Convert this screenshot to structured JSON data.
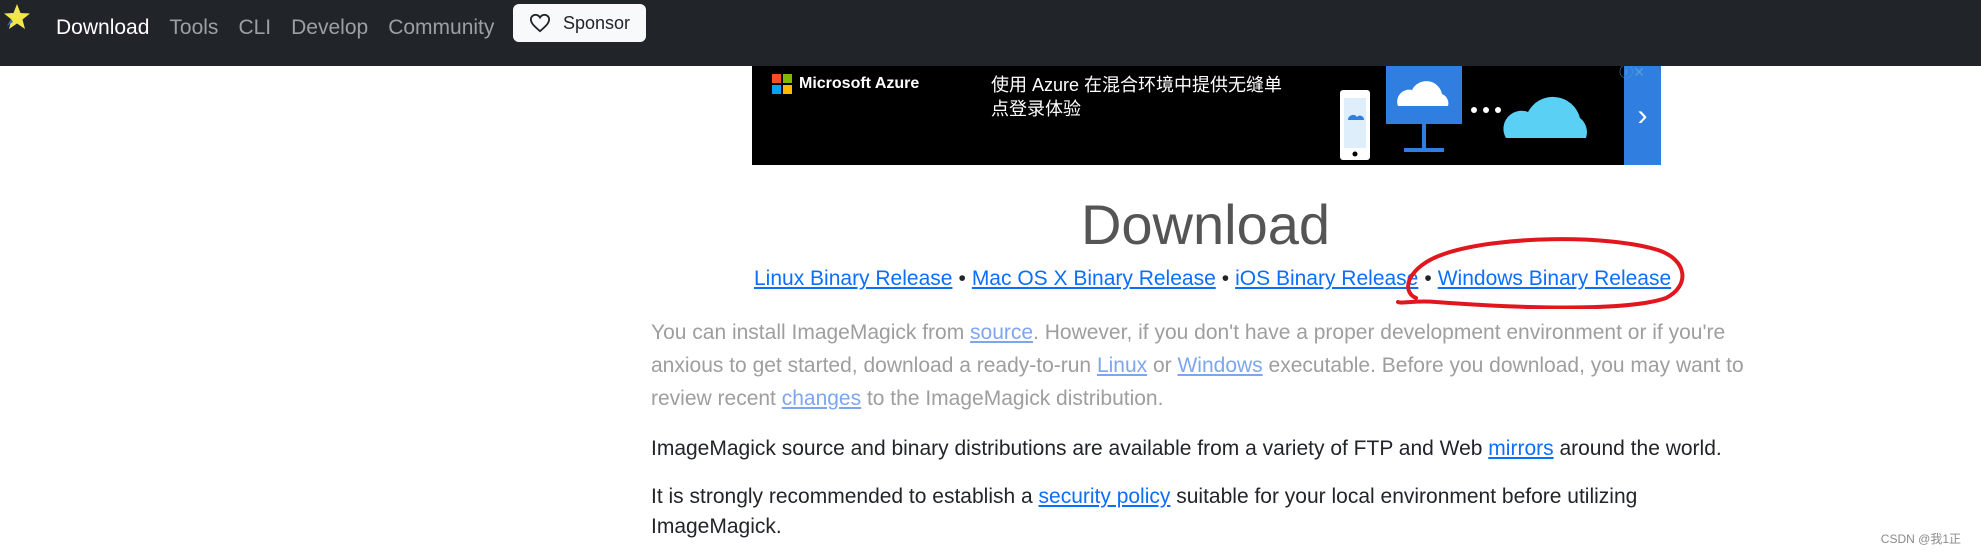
{
  "navbar": {
    "brand_icon": "star-logo-icon",
    "items": [
      {
        "label": "Download",
        "active": true
      },
      {
        "label": "Tools",
        "active": false
      },
      {
        "label": "CLI",
        "active": false
      },
      {
        "label": "Develop",
        "active": false
      },
      {
        "label": "Community",
        "active": false
      }
    ],
    "sponsor": {
      "label": "Sponsor",
      "icon": "heart-outline-icon"
    }
  },
  "ad": {
    "brand": "Microsoft Azure",
    "text": "使用 Azure 在混合环境中提供无缝单点登录体验",
    "arrow_icon": "chevron-right-icon",
    "colors": {
      "background": "#000000",
      "arrow_bg": "#2f7ee0",
      "cloud": "#5ad0f5"
    }
  },
  "page": {
    "title": "Download",
    "release_links": [
      {
        "label": "Linux Binary Release"
      },
      {
        "label": "Mac OS X Binary Release"
      },
      {
        "label": "iOS Binary Release"
      },
      {
        "label": "Windows Binary Release"
      }
    ],
    "separator": "•",
    "intro": {
      "t1": "You can install ImageMagick from ",
      "link_source": "source",
      "t2": ". However, if you don't have a proper development environment or if you're anxious to get started, download a ready-to-run ",
      "link_linux": "Linux",
      "t3": " or ",
      "link_windows": "Windows",
      "t4": " executable. Before you download, you may want to review recent ",
      "link_changes": "changes",
      "t5": " to the ImageMagick distribution."
    },
    "mirrors": {
      "t1": "ImageMagick source and binary distributions are available from a variety of FTP and Web ",
      "link": "mirrors",
      "t2": " around the world."
    },
    "security": {
      "t1": "It is strongly recommended to establish a ",
      "link": "security policy",
      "t2": " suitable for your local environment before utilizing ImageMagick."
    }
  },
  "annotation": {
    "color": "#e0171e"
  },
  "watermark": "CSDN @我1正",
  "colors": {
    "navbar": "#212529",
    "link": "#0d6efd"
  }
}
